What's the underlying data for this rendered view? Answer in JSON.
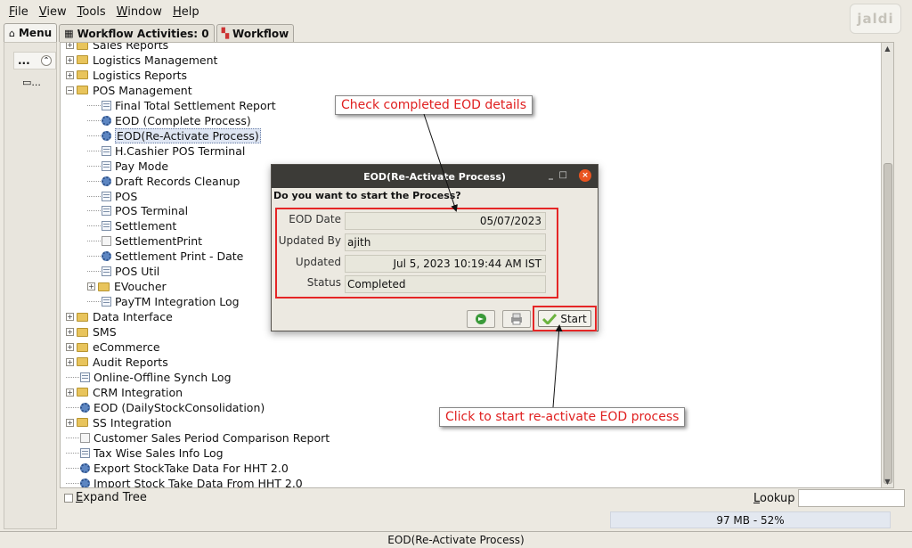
{
  "menubar": {
    "items": [
      {
        "mnemonic": "F",
        "rest": "ile"
      },
      {
        "mnemonic": "V",
        "rest": "iew"
      },
      {
        "mnemonic": "T",
        "rest": "ools"
      },
      {
        "mnemonic": "W",
        "rest": "indow"
      },
      {
        "mnemonic": "H",
        "rest": "elp"
      }
    ],
    "logo_text": "jaldi"
  },
  "tabs": [
    {
      "label": "Menu",
      "icon": "home-icon"
    },
    {
      "label": "Workflow Activities: 0",
      "icon": "table-icon"
    },
    {
      "label": "Workflow",
      "icon": "workflow-icon"
    }
  ],
  "left_strip": {
    "top_label": "...",
    "item_label": "..."
  },
  "tree": {
    "items": [
      {
        "label": "Sales Reports",
        "type": "folder",
        "expander": "+"
      },
      {
        "label": "Logistics Management",
        "type": "folder",
        "expander": "+"
      },
      {
        "label": "Logistics Reports",
        "type": "folder",
        "expander": "+"
      },
      {
        "label": "POS Management",
        "type": "folder-open",
        "expander": "−"
      },
      {
        "label": "Final Total Settlement Report",
        "type": "doc"
      },
      {
        "label": "EOD (Complete Process)",
        "type": "gear"
      },
      {
        "label": "EOD(Re-Activate Process)",
        "type": "gear",
        "selected": true
      },
      {
        "label": "H.Cashier POS Terminal",
        "type": "doc"
      },
      {
        "label": "Pay Mode",
        "type": "doc"
      },
      {
        "label": "Draft Records Cleanup",
        "type": "gear"
      },
      {
        "label": "POS",
        "type": "doc"
      },
      {
        "label": "POS Terminal",
        "type": "doc"
      },
      {
        "label": "Settlement",
        "type": "doc"
      },
      {
        "label": "SettlementPrint",
        "type": "page"
      },
      {
        "label": "Settlement Print - Date",
        "type": "gear"
      },
      {
        "label": "POS Util",
        "type": "doc"
      },
      {
        "label": "EVoucher",
        "type": "folder",
        "expander": "+"
      },
      {
        "label": "PayTM Integration Log",
        "type": "doc"
      },
      {
        "label": "Data Interface",
        "type": "folder",
        "expander": "+"
      },
      {
        "label": "SMS",
        "type": "folder",
        "expander": "+"
      },
      {
        "label": "eCommerce",
        "type": "folder",
        "expander": "+"
      },
      {
        "label": "Audit Reports",
        "type": "folder",
        "expander": "+"
      },
      {
        "label": "Online-Offline Synch Log",
        "type": "doc"
      },
      {
        "label": "CRM Integration",
        "type": "folder",
        "expander": "+"
      },
      {
        "label": "EOD (DailyStockConsolidation)",
        "type": "gear"
      },
      {
        "label": "SS Integration",
        "type": "folder",
        "expander": "+"
      },
      {
        "label": "Customer Sales Period Comparison Report",
        "type": "page"
      },
      {
        "label": "Tax Wise Sales Info Log",
        "type": "doc"
      },
      {
        "label": "Export StockTake Data For HHT 2.0",
        "type": "gear"
      },
      {
        "label": "Import Stock Take Data From HHT 2.0",
        "type": "gear"
      }
    ]
  },
  "bottom": {
    "expand_tree_mnemonic": "E",
    "expand_tree_rest": "xpand Tree",
    "lookup_mnemonic": "L",
    "lookup_rest": "ookup",
    "lookup_value": "",
    "memory": "97 MB - 52%",
    "status": "EOD(Re-Activate Process)"
  },
  "dialog": {
    "title": "EOD(Re-Activate Process)",
    "question": "Do you want to start the Process?",
    "fields": [
      {
        "label": "EOD Date",
        "value": "05/07/2023"
      },
      {
        "label": "Updated By",
        "value": "ajith"
      },
      {
        "label": "Updated",
        "value": "Jul 5, 2023 10:19:44 AM IST"
      },
      {
        "label": "Status",
        "value": "Completed"
      }
    ],
    "start_label": "Start",
    "controls": {
      "minimize": "_",
      "maximize": "□",
      "close": "×"
    }
  },
  "callouts": {
    "top": "Check completed EOD details",
    "bottom": "Click to start re-activate EOD process"
  },
  "colors": {
    "accent_red": "#e52626",
    "title_bar": "#3c3b37",
    "close_button": "#e95420",
    "folder": "#e8c45c"
  }
}
